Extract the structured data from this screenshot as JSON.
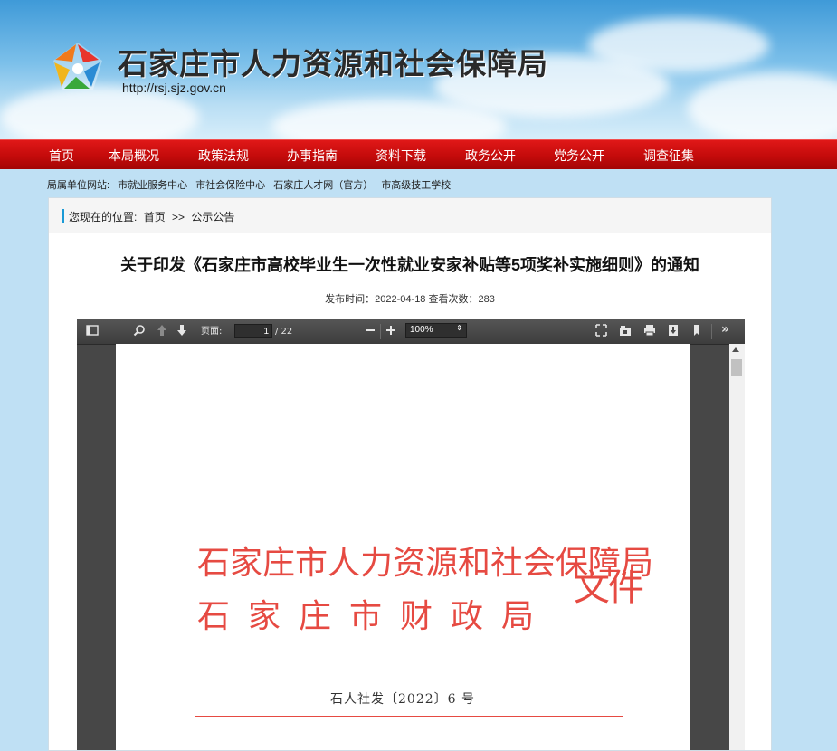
{
  "header": {
    "title": "石家庄市人力资源和社会保障局",
    "url": "http://rsj.sjz.gov.cn"
  },
  "nav": {
    "items": [
      "首页",
      "本局概况",
      "政策法规",
      "办事指南",
      "资料下载",
      "政务公开",
      "党务公开",
      "调查征集"
    ]
  },
  "affiliates": {
    "label": "局属单位网站:",
    "links": [
      "市就业服务中心",
      "市社会保险中心",
      "石家庄人才网（官方）",
      "市高级技工学校"
    ]
  },
  "breadcrumb": {
    "prefix": "您现在的位置:",
    "home": "首页",
    "separator": ">>",
    "current": "公示公告"
  },
  "article": {
    "title": "关于印发《石家庄市高校毕业生一次性就业安家补贴等5项奖补实施细则》的通知",
    "meta": "发布时间：2022-04-18  查看次数：283"
  },
  "pdf_viewer": {
    "page_label": "页面:",
    "current_page": "1",
    "total_pages": "/ 22",
    "zoom": "100%",
    "icons": [
      "sidebar-toggle-icon",
      "search-icon",
      "previous-page-icon",
      "next-page-icon",
      "zoom-out-icon",
      "zoom-in-icon",
      "presentation-mode-icon",
      "open-file-icon",
      "print-icon",
      "download-icon",
      "bookmark-icon",
      "tools-icon"
    ]
  },
  "document": {
    "issuer_line1": "石家庄市人力资源和社会保障局",
    "issuer_line2": "石家庄市财政局",
    "suffix": "文件",
    "doc_number": "石人社发〔2022〕6 号"
  },
  "colors": {
    "nav_red": "#c40b0b",
    "doc_red": "#e64a42",
    "accent_blue": "#1a9ad6",
    "viewer_dark": "#474747"
  }
}
